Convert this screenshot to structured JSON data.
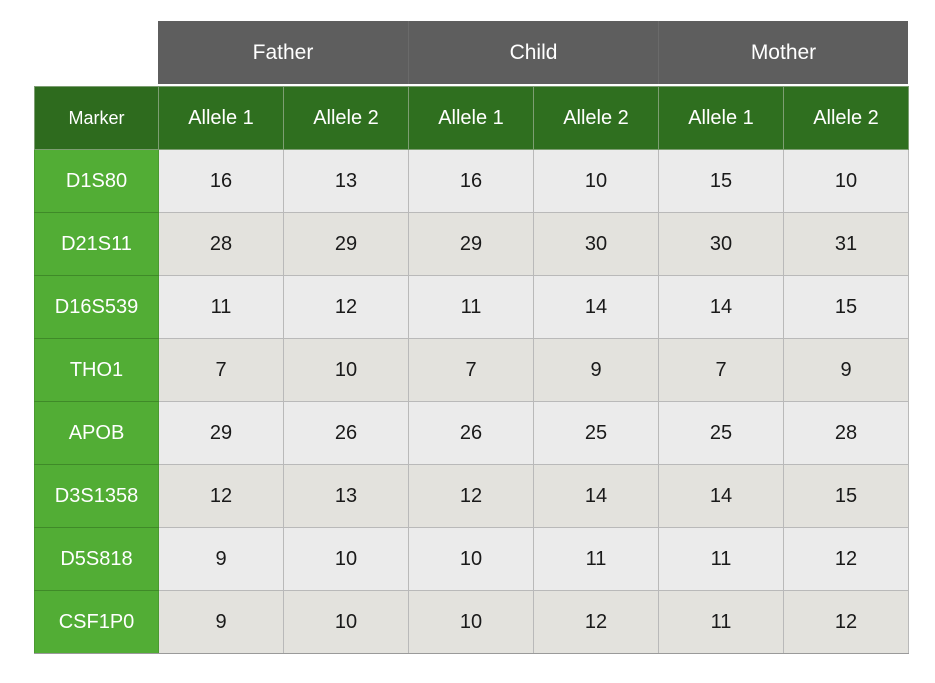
{
  "groups": [
    "Father",
    "Child",
    "Mother"
  ],
  "columns": {
    "marker": "Marker",
    "alleles": [
      "Allele 1",
      "Allele 2",
      "Allele 1",
      "Allele 2",
      "Allele 1",
      "Allele 2"
    ]
  },
  "colors": {
    "group_header": "#5e5e5e",
    "column_header": "#2f6f1f",
    "marker_cell": "#52ad35",
    "row_light": "#ebebeb",
    "row_dark": "#e3e2dd"
  },
  "rows": [
    {
      "marker": "D1S80",
      "values": [
        "16",
        "13",
        "16",
        "10",
        "15",
        "10"
      ]
    },
    {
      "marker": "D21S11",
      "values": [
        "28",
        "29",
        "29",
        "30",
        "30",
        "31"
      ]
    },
    {
      "marker": "D16S539",
      "values": [
        "11",
        "12",
        "11",
        "14",
        "14",
        "15"
      ]
    },
    {
      "marker": "THO1",
      "values": [
        "7",
        "10",
        "7",
        "9",
        "7",
        "9"
      ]
    },
    {
      "marker": "APOB",
      "values": [
        "29",
        "26",
        "26",
        "25",
        "25",
        "28"
      ]
    },
    {
      "marker": "D3S1358",
      "values": [
        "12",
        "13",
        "12",
        "14",
        "14",
        "15"
      ]
    },
    {
      "marker": "D5S818",
      "values": [
        "9",
        "10",
        "10",
        "11",
        "11",
        "12"
      ]
    },
    {
      "marker": "CSF1P0",
      "values": [
        "9",
        "10",
        "10",
        "12",
        "11",
        "12"
      ]
    }
  ]
}
